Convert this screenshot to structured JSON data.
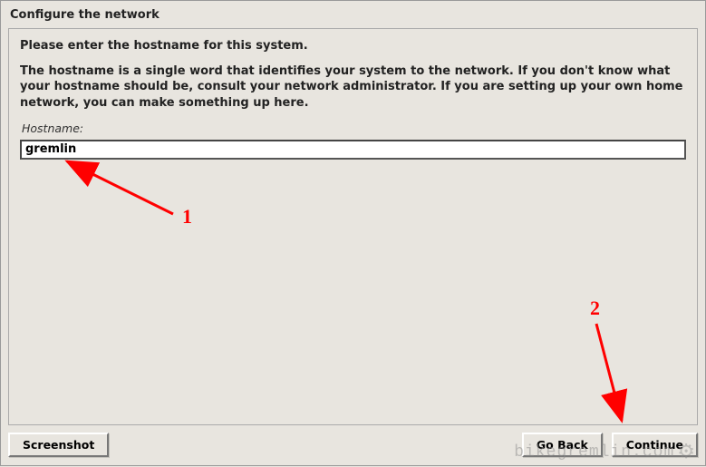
{
  "window": {
    "title": "Configure the network"
  },
  "main": {
    "prompt": "Please enter the hostname for this system.",
    "description": "The hostname is a single word that identifies your system to the network. If you don't know what your hostname should be, consult your network administrator. If you are setting up your own home network, you can make something up here.",
    "hostname_label": "Hostname:",
    "hostname_value": "gremlin"
  },
  "buttons": {
    "screenshot": "Screenshot",
    "go_back": "Go Back",
    "continue": "Continue"
  },
  "annotations": {
    "label1": "1",
    "label2": "2"
  },
  "watermark": {
    "text": "bikegremlin.com"
  }
}
